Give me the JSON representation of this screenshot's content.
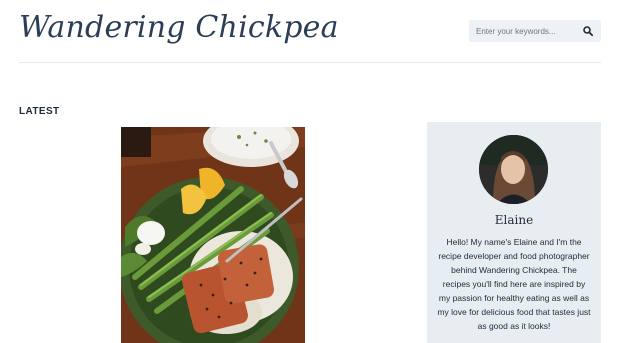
{
  "header": {
    "site_title": "Wandering Chickpea",
    "search": {
      "placeholder": "Enter your keywords...",
      "value": "",
      "icon": "search-icon"
    }
  },
  "latest": {
    "heading": "LATEST",
    "post_image_alt": "salmon-icon"
  },
  "sidebar": {
    "author_name": "Elaine",
    "bio": "Hello! My name's Elaine and I'm the recipe developer and food photographer behind Wandering Chickpea. The recipes you'll find here are inspired by my passion for healthy eating as well as my love for delicious food that tastes just as good as it looks!"
  },
  "colors": {
    "accent": "#2c3e55",
    "sidebar_bg": "#e8edf2",
    "search_bg": "#eef1f5"
  }
}
